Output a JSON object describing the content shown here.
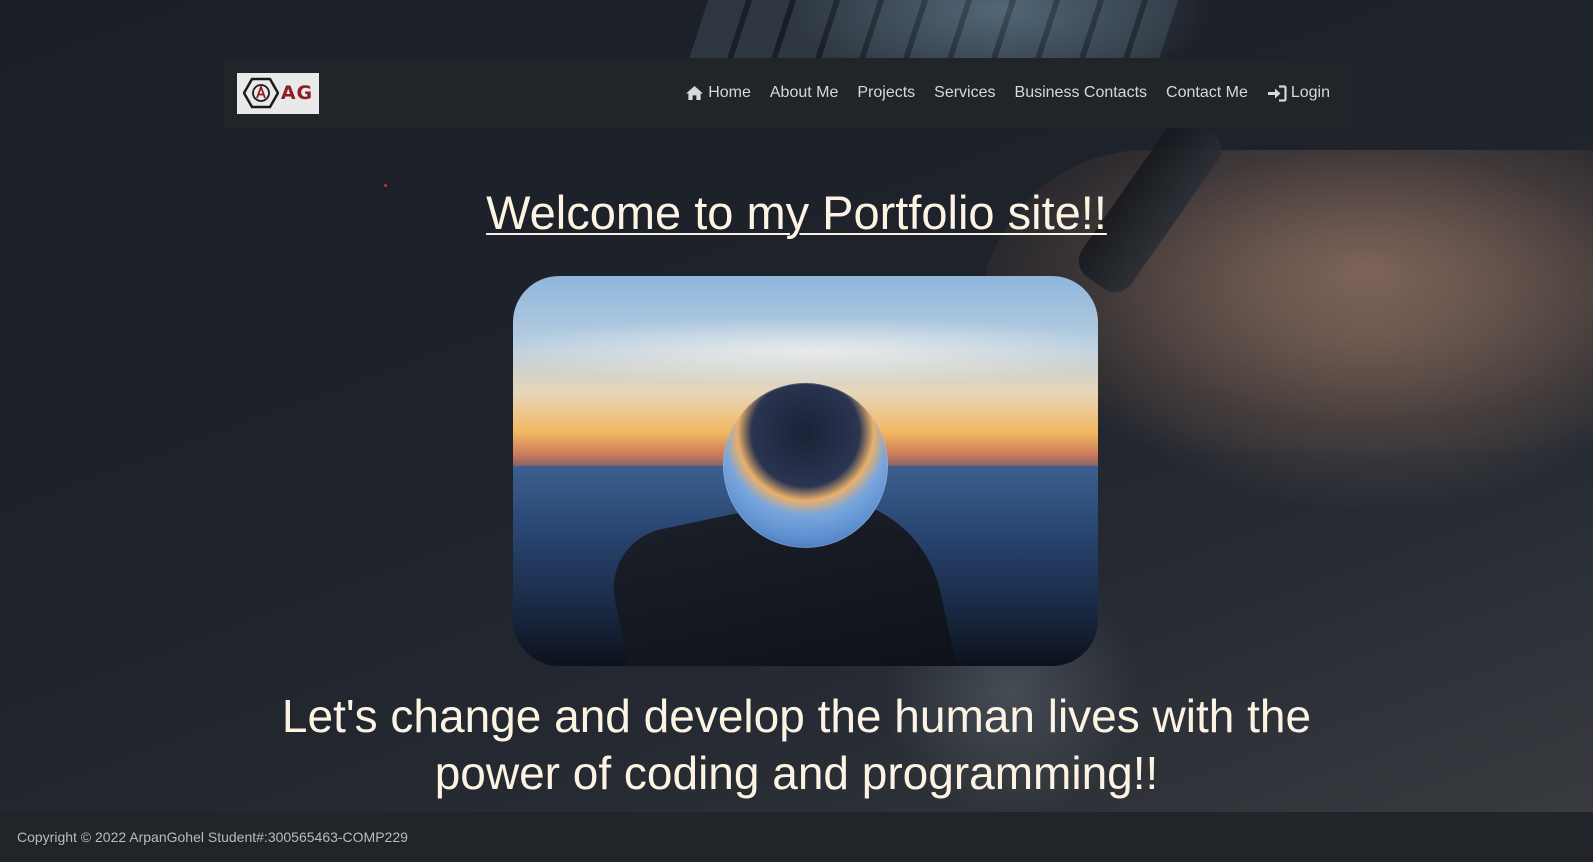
{
  "navbar": {
    "logo_text": "AG",
    "links": [
      {
        "label": "Home",
        "icon": "home-icon"
      },
      {
        "label": "About Me"
      },
      {
        "label": "Projects"
      },
      {
        "label": "Services"
      },
      {
        "label": "Business Contacts"
      },
      {
        "label": "Contact Me"
      },
      {
        "label": "Login",
        "icon": "login-icon"
      }
    ]
  },
  "hero": {
    "title": "Welcome to my Portfolio site!!",
    "tagline": "Let's change and develop the human lives with the power of coding and programming!!"
  },
  "footer": {
    "copyright": "Copyright © 2022 ArpanGohel Student#:300565463-COMP229"
  },
  "colors": {
    "navbar_bg": "#212429",
    "nav_text": "#d7d8da",
    "hero_text": "#fcf3e3",
    "logo_accent": "#8b1e24"
  }
}
